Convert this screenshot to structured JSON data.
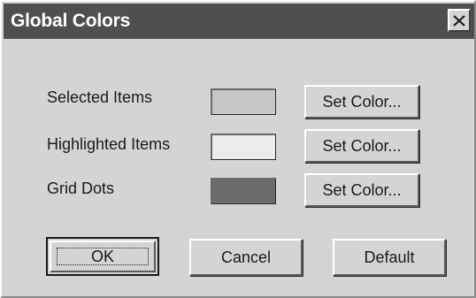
{
  "window": {
    "title": "Global Colors",
    "close_symbol": "×"
  },
  "colors": {
    "titlebar": "#4f4f4f",
    "dialog_face": "#d4d4d4"
  },
  "color_settings": [
    {
      "label": "Selected Items",
      "swatch_color": "#c6c6c6",
      "button_label": "Set Color..."
    },
    {
      "label": "Highlighted Items",
      "swatch_color": "#ececec",
      "button_label": "Set Color..."
    },
    {
      "label": "Grid Dots",
      "swatch_color": "#6b6b6b",
      "button_label": "Set Color..."
    }
  ],
  "actions": {
    "ok_label": "OK",
    "cancel_label": "Cancel",
    "default_label": "Default"
  }
}
